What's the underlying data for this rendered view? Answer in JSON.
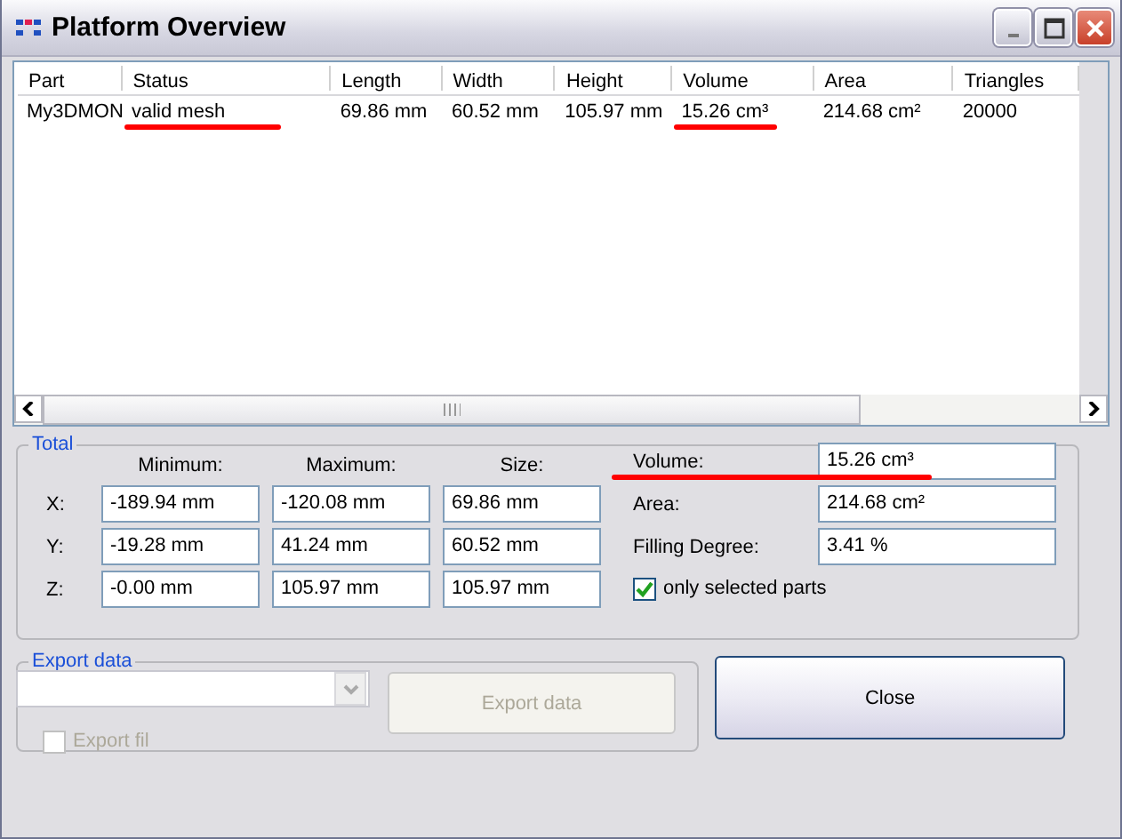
{
  "window": {
    "title": "Platform Overview"
  },
  "table": {
    "columns": [
      "Part",
      "Status",
      "Length",
      "Width",
      "Height",
      "Volume",
      "Area",
      "Triangles"
    ],
    "rows": [
      {
        "cells": [
          {
            "text": "My3DMON",
            "underlined": false
          },
          {
            "text": "valid mesh",
            "underlined": true
          },
          {
            "text": "69.86 mm",
            "underlined": false
          },
          {
            "text": "60.52 mm",
            "underlined": false
          },
          {
            "text": "105.97 mm",
            "underlined": false
          },
          {
            "text": "15.26 cm³",
            "underlined": true
          },
          {
            "text": "214.68 cm²",
            "underlined": false
          },
          {
            "text": "20000",
            "underlined": false
          }
        ]
      }
    ]
  },
  "total": {
    "title": "Total",
    "headers": [
      "Minimum:",
      "Maximum:",
      "Size:"
    ],
    "axes": [
      {
        "label": "X:",
        "values": [
          "-189.94 mm",
          "-120.08 mm",
          "69.86 mm"
        ]
      },
      {
        "label": "Y:",
        "values": [
          "-19.28 mm",
          "41.24 mm",
          "60.52 mm"
        ]
      },
      {
        "label": "Z:",
        "values": [
          "-0.00 mm",
          "105.97 mm",
          "105.97 mm"
        ]
      }
    ],
    "summary": [
      {
        "label": "Volume:",
        "value": "15.26 cm³",
        "underlined": true
      },
      {
        "label": "Area:",
        "value": "214.68 cm²",
        "underlined": false
      },
      {
        "label": "Filling Degree:",
        "value": "3.41 %",
        "underlined": false
      }
    ],
    "checkbox": {
      "label": "only selected parts",
      "checked": true
    }
  },
  "export": {
    "title": "Export data",
    "button": "Export data",
    "disabled": true,
    "checkbox": {
      "label": "Export fil",
      "checked": false
    }
  },
  "buttons": [
    "Close"
  ]
}
